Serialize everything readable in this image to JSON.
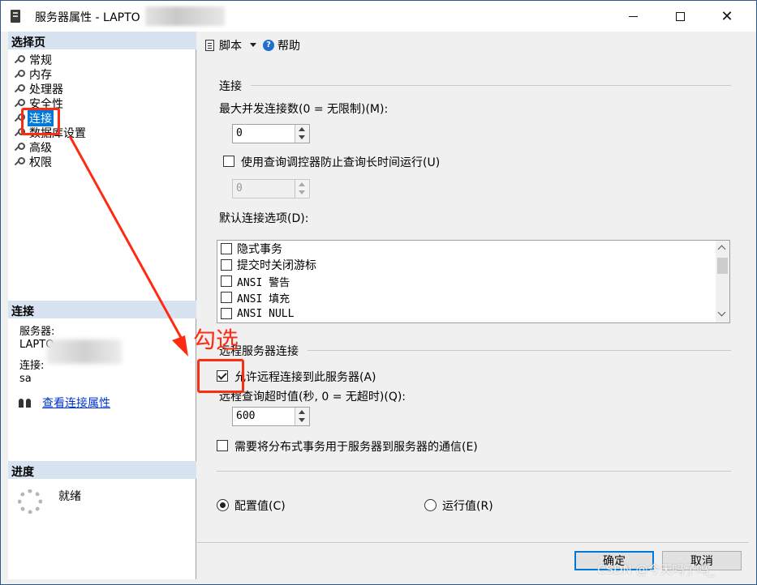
{
  "window": {
    "title": "服务器属性 - LAPTO"
  },
  "left": {
    "select_page_header": "选择页",
    "pages": [
      {
        "label": "常规"
      },
      {
        "label": "内存"
      },
      {
        "label": "处理器"
      },
      {
        "label": "安全性"
      },
      {
        "label": "连接",
        "selected": true
      },
      {
        "label": "数据库设置"
      },
      {
        "label": "高级"
      },
      {
        "label": "权限"
      }
    ],
    "connection_header": "连接",
    "server_label": "服务器:",
    "server_value": "LAPTO",
    "connection_label": "连接:",
    "connection_value": "sa",
    "view_link": "查看连接属性",
    "progress_header": "进度",
    "progress_status": "就绪"
  },
  "toolbar": {
    "script_label": "脚本",
    "help_label": "帮助"
  },
  "main": {
    "conn_group": "连接",
    "max_conn_label": "最大并发连接数(0 = 无限制)(M):",
    "max_conn_value": "0",
    "query_governor_label": "使用查询调控器防止查询长时间运行(U)",
    "query_governor_value": "0",
    "default_options_label": "默认连接选项(D):",
    "default_options": [
      {
        "label": "隐式事务"
      },
      {
        "label": "提交时关闭游标"
      },
      {
        "label": "ANSI 警告"
      },
      {
        "label": "ANSI 填充"
      },
      {
        "label": "ANSI NULL"
      }
    ],
    "remote_group": "远程服务器连接",
    "allow_remote_label": "允许远程连接到此服务器(A)",
    "remote_timeout_label": "远程查询超时值(秒, 0 = 无超时)(Q):",
    "remote_timeout_value": "600",
    "distributed_label": "需要将分布式事务用于服务器到服务器的通信(E)",
    "config_value_label": "配置值(C)",
    "running_value_label": "运行值(R)"
  },
  "buttons": {
    "ok": "确定",
    "cancel": "取消"
  },
  "annotation": {
    "text": "勾选",
    "color": "#ff2a12"
  },
  "watermark": "CSDN @今天吗了吗_",
  "colors": {
    "selected": "#0078d7",
    "section_header": "#d7e3f1",
    "link": "#0033cc"
  }
}
